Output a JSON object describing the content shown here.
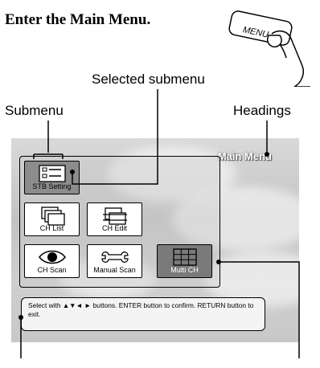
{
  "instruction": "Enter the Main Menu.",
  "menu_button_label": "MENU",
  "callouts": {
    "selected_submenu": "Selected submenu",
    "submenu": "Submenu",
    "headings": "Headings"
  },
  "screen": {
    "title": "Main Menu",
    "tiles": [
      {
        "label": "STB Setting",
        "icon": "settings-checklist-icon",
        "state": "selected"
      },
      {
        "label": "CH List",
        "icon": "stacked-windows-icon",
        "state": "normal"
      },
      {
        "label": "CH Edit",
        "icon": "edit-list-icon",
        "state": "normal"
      },
      {
        "label": "CH Scan",
        "icon": "eye-icon",
        "state": "normal"
      },
      {
        "label": "Manual Scan",
        "icon": "wrench-icon",
        "state": "normal"
      },
      {
        "label": "Multi CH",
        "icon": "grid-icon",
        "state": "highlighted"
      }
    ],
    "help_text": "Select with ▲▼◄ ► buttons. ENTER button to confirm. RETURN button to exit."
  },
  "colors": {
    "selected_tile": "#8c8c8c",
    "highlighted_tile": "#7a7a7a",
    "screen_bg": "#cccccc"
  }
}
